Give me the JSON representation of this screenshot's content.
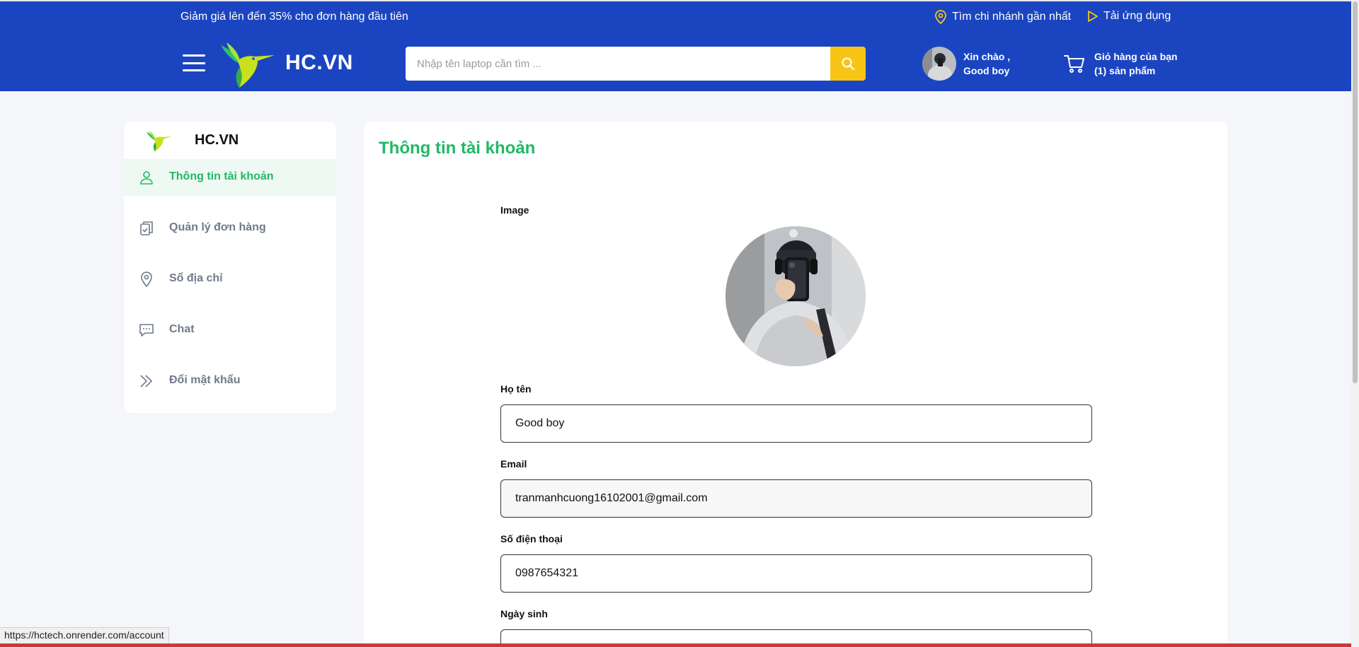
{
  "header": {
    "promo": "Giảm giá lên đến 35% cho đơn hàng đầu tiên",
    "find_branch": "Tìm chi nhánh gần nhất",
    "download_app": "Tải ứng dụng",
    "brand": "HC.VN",
    "search_placeholder": "Nhập tên laptop cần tìm ...",
    "greeting_line1": "Xin chào ,",
    "greeting_line2": "Good boy",
    "cart_line1": "Giỏ hàng của bạn",
    "cart_line2": "(1) sản phẩm",
    "colors": {
      "primary": "#1b45c0",
      "search_button": "#f8c514"
    }
  },
  "sidebar": {
    "brand": "HC.VN",
    "items": [
      {
        "label": "Thông tin tài khoản",
        "icon": "user-icon",
        "active": true
      },
      {
        "label": "Quản lý đơn hàng",
        "icon": "clipboard-icon",
        "active": false
      },
      {
        "label": "Sổ địa chỉ",
        "icon": "location-pin-icon",
        "active": false
      },
      {
        "label": "Chat",
        "icon": "chat-icon",
        "active": false
      },
      {
        "label": "Đổi mật khẩu",
        "icon": "double-chevron-right-icon",
        "active": false
      }
    ],
    "active_color": "#22b866"
  },
  "account": {
    "title": "Thông tin tài khoản",
    "image_label": "Image",
    "name_label": "Họ tên",
    "name_value": "Good boy",
    "email_label": "Email",
    "email_value": "tranmanhcuong16102001@gmail.com",
    "phone_label": "Số điện thoại",
    "phone_value": "0987654321",
    "dob_label": "Ngày sinh"
  },
  "status_bar": {
    "url": "https://hctech.onrender.com/account"
  }
}
